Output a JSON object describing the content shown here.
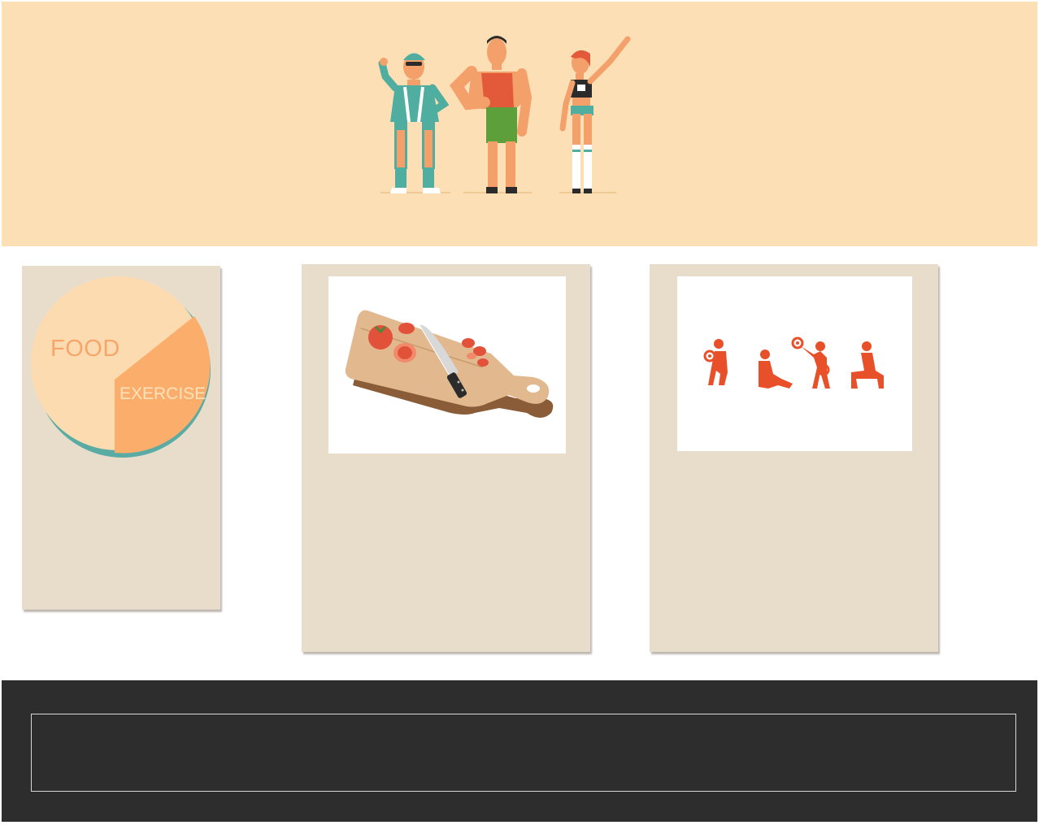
{
  "hero": {
    "illustration": "three-athletes-illustration",
    "background": "#fddfb5"
  },
  "cards": {
    "pie": {
      "food_label": "FOOD",
      "exercise_label": "EXERCISE",
      "colors": {
        "food": "#fddbb0",
        "exercise": "#fbad6b",
        "shadow": "#5aaba4"
      }
    },
    "food": {
      "image": "cutting-board-with-tomatoes-and-knife"
    },
    "exercise": {
      "image": "exercise-pictograms",
      "accent": "#e8502a"
    }
  },
  "colors": {
    "card_bg": "#e8ddcb",
    "footer_bg": "#2d2d2d"
  }
}
